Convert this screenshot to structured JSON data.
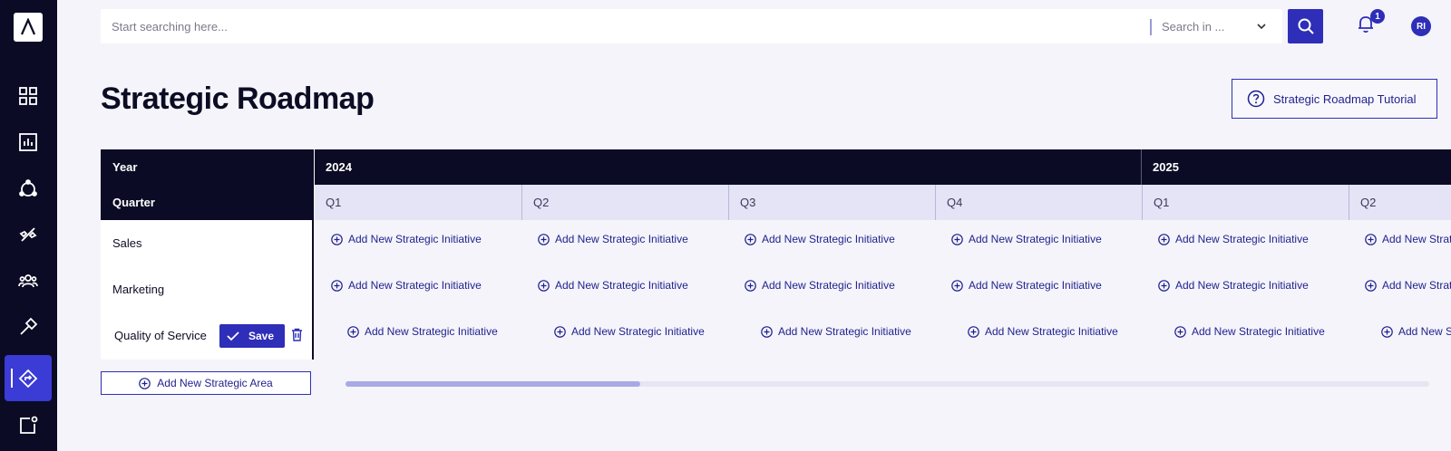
{
  "search": {
    "placeholder": "Start searching here...",
    "scope_placeholder": "Search in ..."
  },
  "notifications": {
    "count": "1"
  },
  "user": {
    "initials": "RI"
  },
  "page": {
    "title": "Strategic Roadmap",
    "tutorial_label": "Strategic Roadmap Tutorial"
  },
  "grid": {
    "year_label": "Year",
    "quarter_label": "Quarter",
    "years": [
      "2024",
      "2025"
    ],
    "quarters": [
      "Q1",
      "Q2",
      "Q3",
      "Q4",
      "Q1",
      "Q2"
    ],
    "areas": [
      "Sales",
      "Marketing",
      "Quality of Service"
    ],
    "add_initiative_label": "Add New Strategic Initiative",
    "save_label": "Save"
  },
  "footer": {
    "add_area_label": "Add New Strategic Area"
  },
  "sidebar": {
    "items": [
      "dashboard-icon",
      "reports-icon",
      "network-icon",
      "integrations-icon",
      "team-icon",
      "tools-icon",
      "roadmap-icon",
      "external-icon"
    ],
    "active": "roadmap-icon"
  },
  "colors": {
    "sidebar_bg": "#0b0b25",
    "accent": "#2e2eb8",
    "active_nav": "#3b3bd6",
    "quarter_bg": "#e4e4f6"
  }
}
